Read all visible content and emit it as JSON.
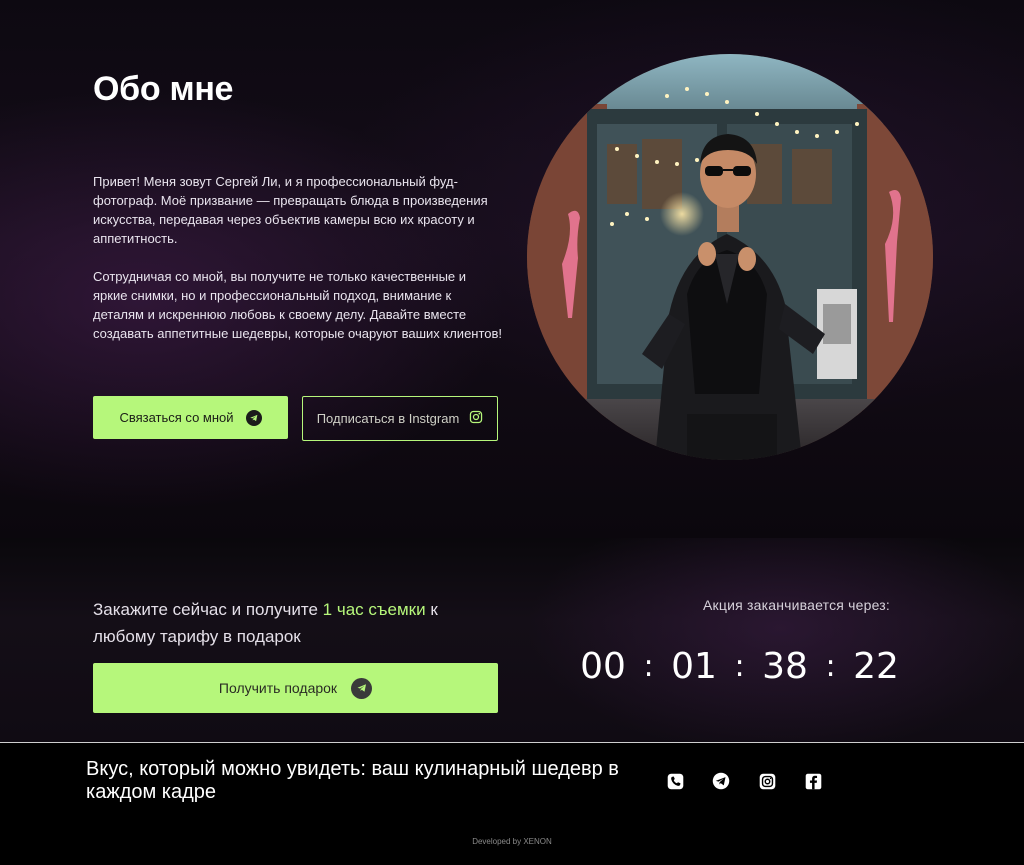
{
  "about": {
    "title": "Обо мне",
    "paragraph1": "Привет! Меня зовут Сергей Ли, и я профессиональный фуд-фотограф. Моё призвание — превращать блюда в произведения искусства, передавая через объектив камеры всю их красоту и аппетитность.",
    "paragraph2": "Сотрудничая со мной, вы получите не только качественные и яркие снимки, но и профессиональный подход, внимание к деталям и искреннюю любовь к своему делу. Давайте вместе создавать аппетитные шедевры, которые очаруют ваших клиентов!",
    "contact_button": {
      "label": "Связаться со мной",
      "icon": "telegram-icon"
    },
    "instagram_button": {
      "label": "Подписаться в Instgram",
      "icon": "instagram-icon"
    },
    "photo": {
      "icon": "photographer-portrait"
    }
  },
  "promo": {
    "text_before": "Закажите сейчас и получите ",
    "text_accent": "1 час съемки",
    "text_after": " к любому тарифу в подарок",
    "gift_button": {
      "label": "Получить подарок",
      "icon": "telegram-icon"
    },
    "timer_label": "Акция заканчивается через:",
    "timer": {
      "days": "00",
      "hours": "01",
      "minutes": "38",
      "seconds": "22",
      "separator": ":"
    }
  },
  "footer": {
    "slogan": "Вкус, который можно увидеть: ваш кулинарный шедевр в каждом кадре",
    "socials": [
      "phone-icon",
      "telegram-icon",
      "instagram-icon",
      "facebook-icon"
    ],
    "developer": "Developed by XENON"
  },
  "colors": {
    "accent": "#b6f77b",
    "background": "#0d0911",
    "footer": "#000000"
  }
}
